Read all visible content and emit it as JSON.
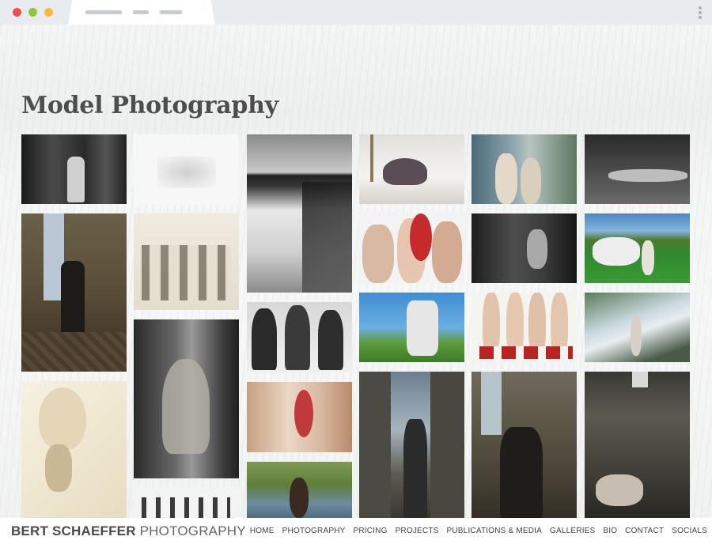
{
  "page": {
    "title": "Model Photography"
  },
  "brand": {
    "name_bold": "BERT SCHAEFFER",
    "name_light": "PHOTOGRAPHY"
  },
  "nav": [
    "HOME",
    "PHOTOGRAPHY",
    "PRICING",
    "PROJECTS",
    "PUBLICATIONS & MEDIA",
    "GALLERIES",
    "BIO",
    "CONTACT",
    "SOCIALS"
  ]
}
